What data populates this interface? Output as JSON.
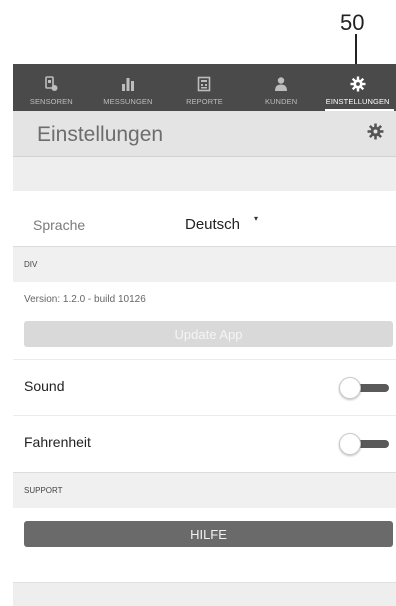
{
  "callout": {
    "number": "50"
  },
  "tabs": [
    {
      "label": "SENSOREN",
      "icon": "sensor-icon"
    },
    {
      "label": "MESSUNGEN",
      "icon": "bar-chart-icon"
    },
    {
      "label": "REPORTE",
      "icon": "report-icon"
    },
    {
      "label": "KUNDEN",
      "icon": "customer-icon"
    },
    {
      "label": "EINSTELLUNGEN",
      "icon": "gear-icon",
      "active": true
    }
  ],
  "header": {
    "title": "Einstellungen",
    "icon": "gear-icon"
  },
  "language": {
    "label": "Sprache",
    "value": "Deutsch",
    "caret": "▾"
  },
  "sections": {
    "div": "DIV",
    "support": "SUPPORT"
  },
  "version": "Version: 1.2.0 - build 10126",
  "buttons": {
    "update": "Update App",
    "help": "HILFE"
  },
  "settings": [
    {
      "label": "Sound",
      "enabled": false
    },
    {
      "label": "Fahrenheit",
      "enabled": false
    }
  ],
  "colors": {
    "tabbar": "#4a4a4a",
    "header": "#e4e4e4",
    "help_button": "#6a6a6a",
    "update_button": "#d9d9d9"
  }
}
